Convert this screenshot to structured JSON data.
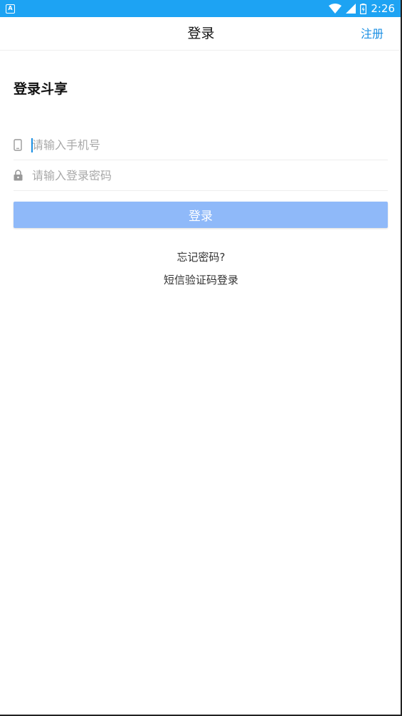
{
  "status_bar": {
    "app_badge": "A",
    "time": "2:26",
    "icons": [
      "wifi-icon",
      "signal-icon",
      "battery-icon"
    ],
    "color": "#1da3f3"
  },
  "header": {
    "title": "登录",
    "register_label": "注册"
  },
  "main": {
    "heading": "登录斗享",
    "phone": {
      "value": "",
      "placeholder": "请输入手机号",
      "icon": "phone-icon"
    },
    "password": {
      "value": "",
      "placeholder": "请输入登录密码",
      "icon": "lock-icon"
    },
    "login_label": "登录",
    "forgot_label": "忘记密码?",
    "sms_login_label": "短信验证码登录"
  },
  "colors": {
    "accent": "#1a8fe3",
    "button": "#8fb9f9",
    "placeholder": "#a9a9a9"
  }
}
